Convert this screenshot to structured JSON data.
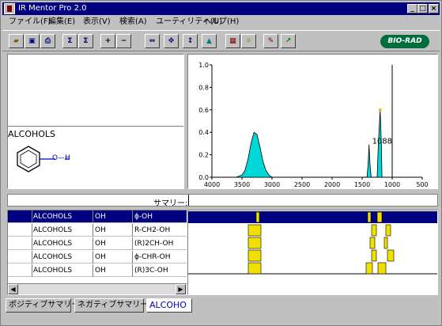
{
  "window": {
    "title": "IR Mentor Pro 2.0"
  },
  "menu": [
    {
      "label": "ファイル(F)"
    },
    {
      "label": "編集(E)"
    },
    {
      "label": "表示(V)"
    },
    {
      "label": "検索(A)"
    },
    {
      "label": "ユーティリティ(U)"
    },
    {
      "label": "ヘルプ(H)"
    }
  ],
  "toolbar": {
    "brand": "BIO-RAD"
  },
  "structure": {
    "name": "ALCOHOLS",
    "group_label": "O—H"
  },
  "summary": {
    "label": "サマリー:"
  },
  "chart_data": {
    "type": "line",
    "xlim": [
      4000,
      500
    ],
    "ylim": [
      0.0,
      1.0
    ],
    "x_ticks": [
      "4000",
      "3500",
      "3000",
      "2500",
      "2000",
      "1500",
      "1000",
      "500"
    ],
    "y_ticks": [
      "0.0",
      "0.2",
      "0.4",
      "0.6",
      "0.8",
      "1.0"
    ],
    "annotation": {
      "text": "1088",
      "x": 1088
    },
    "cursor_x": 1000,
    "series": [
      {
        "x": [
          3600,
          3500,
          3450,
          3400,
          3350,
          3300,
          3250,
          3200,
          3150,
          3100,
          3050,
          3000
        ],
        "y": [
          0.0,
          0.02,
          0.06,
          0.16,
          0.3,
          0.4,
          0.38,
          0.27,
          0.14,
          0.06,
          0.02,
          0.0
        ]
      },
      {
        "x": [
          1420,
          1400,
          1385,
          1370,
          1350
        ],
        "y": [
          0.0,
          0.12,
          0.29,
          0.12,
          0.0
        ]
      },
      {
        "x": [
          1250,
          1230,
          1200,
          1180,
          1170
        ],
        "y": [
          0.0,
          0.3,
          0.6,
          0.3,
          0.0
        ]
      }
    ],
    "fill_color": "#00d8d8"
  },
  "table": {
    "rows": [
      {
        "class": "ALCOHOLS",
        "group": "OH",
        "formula": "ϕ-OH",
        "selected": true
      },
      {
        "class": "ALCOHOLS",
        "group": "OH",
        "formula": "R-CH2-OH",
        "selected": false
      },
      {
        "class": "ALCOHOLS",
        "group": "OH",
        "formula": "(R)2CH-OH",
        "selected": false
      },
      {
        "class": "ALCOHOLS",
        "group": "OH",
        "formula": "ϕ-CHR-OH",
        "selected": false
      },
      {
        "class": "ALCOHOLS",
        "group": "OH",
        "formula": "(R)3C-OH",
        "selected": false
      }
    ]
  },
  "tabs": [
    {
      "label": "ポジティブサマリー"
    },
    {
      "label": "ネガティブサマリー"
    },
    {
      "label": "ALCOHO"
    }
  ]
}
